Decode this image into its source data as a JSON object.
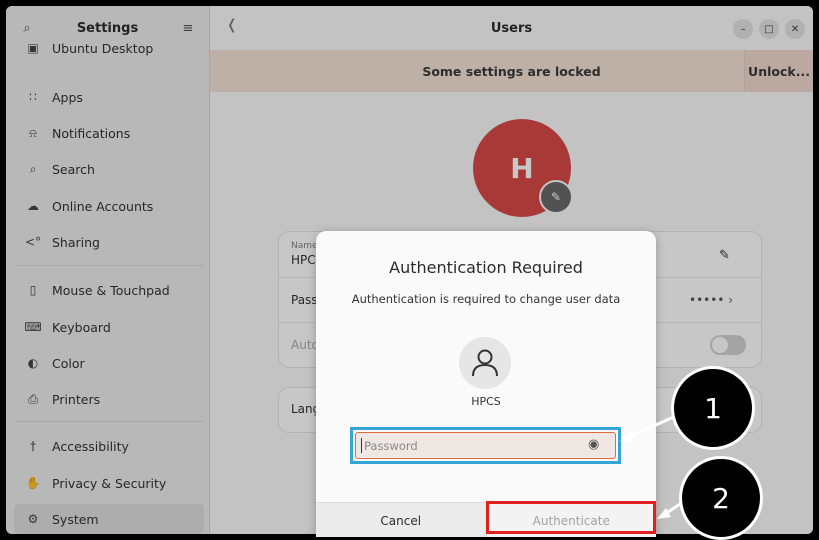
{
  "sidebar": {
    "title": "Settings",
    "items": [
      {
        "label": "Ubuntu Desktop",
        "icon": "desktop-icon"
      },
      {
        "label": "Apps",
        "icon": "apps-grid-icon"
      },
      {
        "label": "Notifications",
        "icon": "bell-icon"
      },
      {
        "label": "Search",
        "icon": "search-icon"
      },
      {
        "label": "Online Accounts",
        "icon": "cloud-icon"
      },
      {
        "label": "Sharing",
        "icon": "share-icon"
      },
      {
        "label": "Mouse & Touchpad",
        "icon": "mouse-icon"
      },
      {
        "label": "Keyboard",
        "icon": "keyboard-icon"
      },
      {
        "label": "Color",
        "icon": "color-icon"
      },
      {
        "label": "Printers",
        "icon": "printer-icon"
      },
      {
        "label": "Accessibility",
        "icon": "accessibility-icon"
      },
      {
        "label": "Privacy & Security",
        "icon": "hand-icon"
      },
      {
        "label": "System",
        "icon": "system-gear-icon"
      }
    ]
  },
  "main": {
    "title": "Users",
    "locked_banner": "Some settings are locked",
    "unlock_button": "Unlock...",
    "avatar_initial": "H",
    "name_small": "Name",
    "name_value": "HPCS",
    "password_label": "Password",
    "password_dots": "•••••",
    "autologin_label": "Automatic Login",
    "language_label": "Language"
  },
  "dialog": {
    "title": "Authentication Required",
    "message": "Authentication is required to change user data",
    "user_name": "HPCS",
    "password_placeholder": "Password",
    "cancel_label": "Cancel",
    "authenticate_label": "Authenticate"
  },
  "callouts": [
    "1",
    "2"
  ],
  "colors": {
    "accent_orange": "#e26b3a",
    "highlight_blue": "#37a4d7",
    "highlight_red": "#e01f1f",
    "avatar_red": "#d84a47"
  }
}
